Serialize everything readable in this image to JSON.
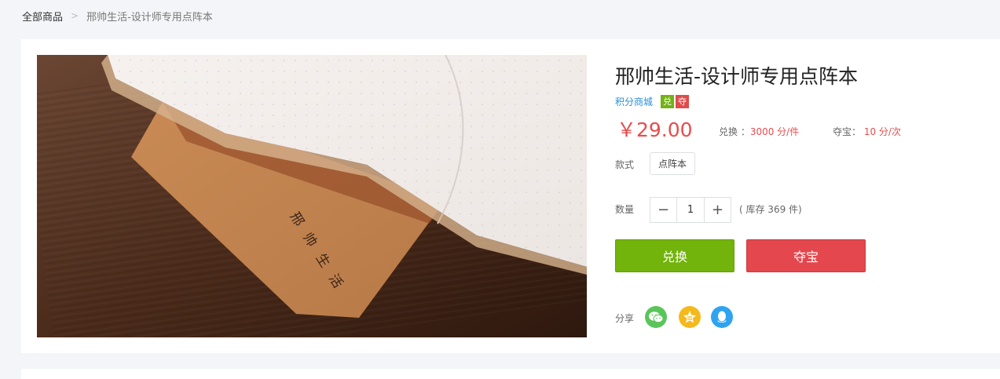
{
  "breadcrumb": {
    "home": "全部商品",
    "separator": ">",
    "current": "邢帅生活-设计师专用点阵本"
  },
  "product": {
    "title": "邢帅生活-设计师专用点阵本",
    "image_alt": "邢帅生活 点阵本",
    "cover_text": "邢帅生活",
    "store_link": "积分商城",
    "tags": {
      "exchange": "兑",
      "lottery": "夺"
    },
    "price": "￥29.00",
    "exchange_label": "兑换 ：",
    "exchange_value": "3000 分/件",
    "lottery_label": "夺宝：",
    "lottery_value": "10 分/次",
    "style_label": "款式",
    "style_option": "点阵本",
    "quantity_label": "数量",
    "quantity_value": "1",
    "quantity_minus": "−",
    "quantity_plus": "+",
    "stock_text": "( 库存 369 件)",
    "exchange_button": "兑换",
    "lottery_button": "夺宝",
    "share_label": "分享",
    "share_icons": [
      "wechat-icon",
      "qzone-icon",
      "qq-icon"
    ]
  },
  "colors": {
    "price_red": "#e84c4c",
    "exchange_green": "#72b30c",
    "lottery_red": "#e4474d",
    "link_blue": "#2a8ed6"
  }
}
